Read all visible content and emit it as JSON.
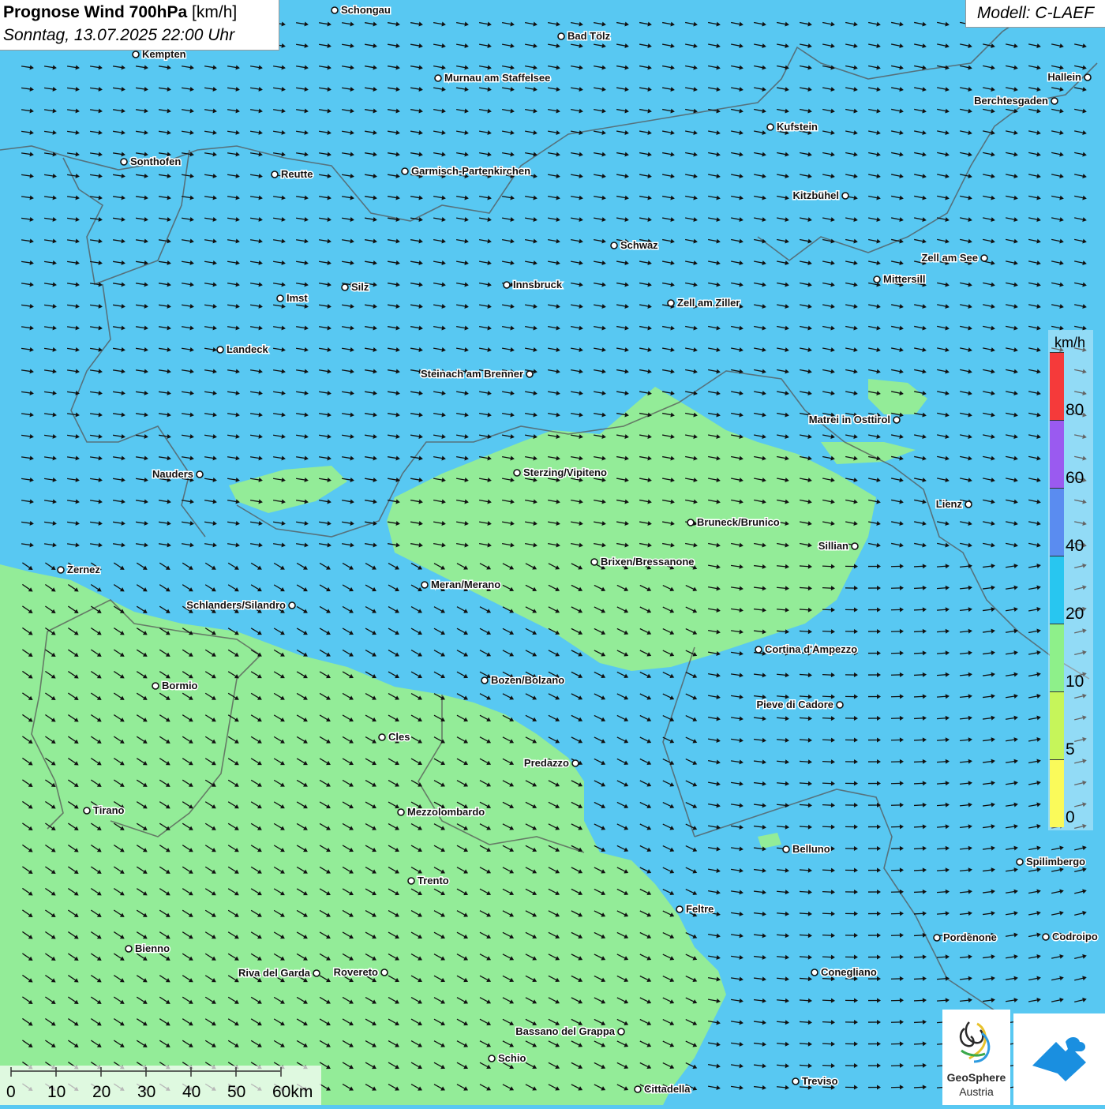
{
  "header": {
    "title_bold": "Prognose Wind 700hPa",
    "title_unit": "[km/h]",
    "datetime": "Sonntag, 13.07.2025 22:00 Uhr",
    "model": "Modell: C-LAEF"
  },
  "legend": {
    "unit": "km/h",
    "bands": [
      {
        "from": 0,
        "to": 5,
        "color": "#fafa5a"
      },
      {
        "from": 5,
        "to": 10,
        "color": "#c6f55a"
      },
      {
        "from": 10,
        "to": 20,
        "color": "#8ef08a"
      },
      {
        "from": 20,
        "to": 40,
        "color": "#28c6f0"
      },
      {
        "from": 40,
        "to": 60,
        "color": "#5a8cf0"
      },
      {
        "from": 60,
        "to": 80,
        "color": "#9a5af0"
      },
      {
        "from": 80,
        "to": 100,
        "color": "#f53a3a"
      }
    ],
    "labels": [
      "80",
      "60",
      "40",
      "20",
      "10",
      "5",
      "0"
    ]
  },
  "scale_bar": {
    "labels": [
      "0",
      "10",
      "20",
      "30",
      "40",
      "50",
      "60km"
    ]
  },
  "cities": [
    {
      "name": "Schongau"
    },
    {
      "name": "Kempten"
    },
    {
      "name": "Bad Tölz"
    },
    {
      "name": "Murnau am Staffelsee"
    },
    {
      "name": "Hallein"
    },
    {
      "name": "Berchtesgaden"
    },
    {
      "name": "Kufstein"
    },
    {
      "name": "Sonthofen"
    },
    {
      "name": "Reutte"
    },
    {
      "name": "Garmisch-Partenkirchen"
    },
    {
      "name": "Kitzbühel"
    },
    {
      "name": "Schwaz"
    },
    {
      "name": "Zell am See"
    },
    {
      "name": "Mittersill"
    },
    {
      "name": "Silz"
    },
    {
      "name": "Innsbruck"
    },
    {
      "name": "Imst"
    },
    {
      "name": "Zell am Ziller"
    },
    {
      "name": "Landeck"
    },
    {
      "name": "Steinach am Brenner"
    },
    {
      "name": "Matrei in Osttirol"
    },
    {
      "name": "Nauders"
    },
    {
      "name": "Sterzing/Vipiteno"
    },
    {
      "name": "Lienz"
    },
    {
      "name": "Bruneck/Brunico"
    },
    {
      "name": "Sillian"
    },
    {
      "name": "Brixen/Bressanone"
    },
    {
      "name": "Zernez"
    },
    {
      "name": "Meran/Merano"
    },
    {
      "name": "Schlanders/Silandro"
    },
    {
      "name": "Cortina d'Ampezzo"
    },
    {
      "name": "Bozen/Bolzano"
    },
    {
      "name": "Bormio"
    },
    {
      "name": "Pieve di Cadore"
    },
    {
      "name": "Cles"
    },
    {
      "name": "Predazzo"
    },
    {
      "name": "Tirano"
    },
    {
      "name": "Mezzolombardo"
    },
    {
      "name": "Belluno"
    },
    {
      "name": "Spilimbergo"
    },
    {
      "name": "Trento"
    },
    {
      "name": "Feltre"
    },
    {
      "name": "Pordenone"
    },
    {
      "name": "Codroipo"
    },
    {
      "name": "Bienno"
    },
    {
      "name": "Riva del Garda"
    },
    {
      "name": "Rovereto"
    },
    {
      "name": "Conegliano"
    },
    {
      "name": "Bassano del Grappa"
    },
    {
      "name": "Schio"
    },
    {
      "name": "Treviso"
    },
    {
      "name": "Cittadella"
    }
  ],
  "logos": {
    "geosphere_line1": "GeoSphere",
    "geosphere_line2": "Austria"
  },
  "colors": {
    "wind_20_40": "#58c8f2",
    "wind_10_20": "#93ec98",
    "arrow": "#111111"
  }
}
